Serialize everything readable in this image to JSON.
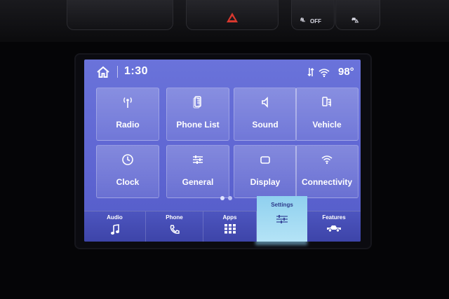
{
  "status_bar": {
    "time": "1:30",
    "temperature": "98°",
    "icons": [
      "home-icon",
      "sync-icon",
      "wifi-icon"
    ]
  },
  "dash": {
    "btn_off_label": "OFF"
  },
  "tiles": [
    {
      "label": "Radio",
      "icon": "radio-antenna-icon"
    },
    {
      "label": "Phone List",
      "icon": "phone-list-icon"
    },
    {
      "label": "Sound",
      "icon": "speaker-icon"
    },
    {
      "label": "Vehicle",
      "icon": "vehicle-settings-icon"
    },
    {
      "label": "Clock",
      "icon": "clock-icon"
    },
    {
      "label": "General",
      "icon": "sliders-icon"
    },
    {
      "label": "Display",
      "icon": "display-icon"
    },
    {
      "label": "Connectivity",
      "icon": "wifi-icon"
    }
  ],
  "pagination": {
    "pages": 2,
    "current": 1
  },
  "bottom_nav": [
    {
      "label": "Audio",
      "icon": "music-note-icon",
      "active": false
    },
    {
      "label": "Phone",
      "icon": "phone-icon",
      "active": false
    },
    {
      "label": "Apps",
      "icon": "apps-grid-icon",
      "active": false
    },
    {
      "label": "Settings",
      "icon": "settings-sliders-icon",
      "active": true
    },
    {
      "label": "Features",
      "icon": "truck-icon",
      "active": false
    }
  ],
  "colors": {
    "screen_bg": "#5e65d2",
    "active_tab": "#a8ddf3",
    "hazard": "#d8382e"
  }
}
